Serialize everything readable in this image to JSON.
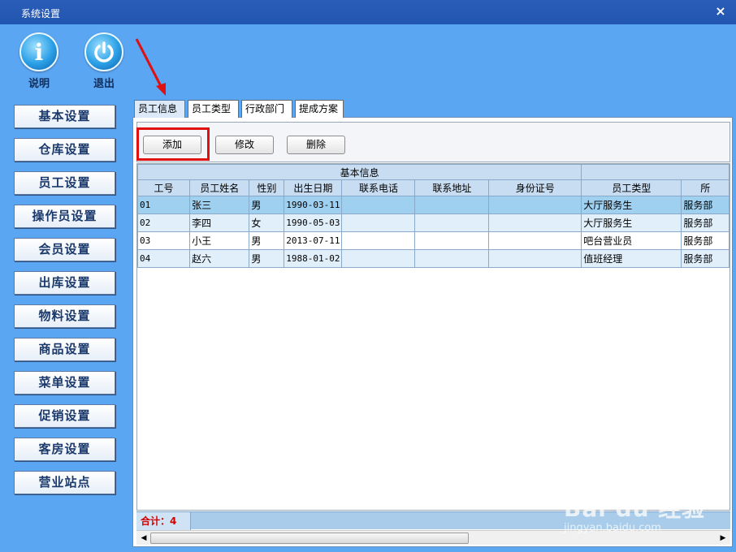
{
  "window": {
    "title": "系统设置",
    "close_glyph": "×"
  },
  "top_buttons": [
    {
      "label": "说明",
      "icon": "info-icon"
    },
    {
      "label": "退出",
      "icon": "power-icon"
    }
  ],
  "sidebar": {
    "items": [
      "基本设置",
      "仓库设置",
      "员工设置",
      "操作员设置",
      "会员设置",
      "出库设置",
      "物料设置",
      "商品设置",
      "菜单设置",
      "促销设置",
      "客房设置",
      "营业站点"
    ]
  },
  "tabs": [
    {
      "label": "员工信息",
      "active": true
    },
    {
      "label": "员工类型",
      "active": false
    },
    {
      "label": "行政部门",
      "active": false
    },
    {
      "label": "提成方案",
      "active": false
    }
  ],
  "toolbar": {
    "add_label": "添加",
    "edit_label": "修改",
    "delete_label": "删除"
  },
  "table": {
    "group_header": "基本信息",
    "columns": [
      "工号",
      "员工姓名",
      "性别",
      "出生日期",
      "联系电话",
      "联系地址",
      "身份证号",
      "员工类型",
      "所"
    ],
    "rows": [
      [
        "01",
        "张三",
        "男",
        "1990-03-11",
        "",
        "",
        "",
        "大厅服务生",
        "服务部"
      ],
      [
        "02",
        "李四",
        "女",
        "1990-05-03",
        "",
        "",
        "",
        "大厅服务生",
        "服务部"
      ],
      [
        "03",
        "小王",
        "男",
        "2013-07-11",
        "",
        "",
        "",
        "吧台营业员",
        "服务部"
      ],
      [
        "04",
        "赵六",
        "男",
        "1988-01-02",
        "",
        "",
        "",
        "值班经理",
        "服务部"
      ]
    ]
  },
  "footer": {
    "total_label": "合计：",
    "total_value": "4"
  },
  "watermark": {
    "logo": "Bai du 经验",
    "url": "jingyan.baidu.com"
  },
  "colors": {
    "title_bar": "#2156b0",
    "background": "#5aa6f2",
    "highlight": "#e01010",
    "row_odd": "#9fd0ef",
    "row_even": "#e1effb"
  }
}
